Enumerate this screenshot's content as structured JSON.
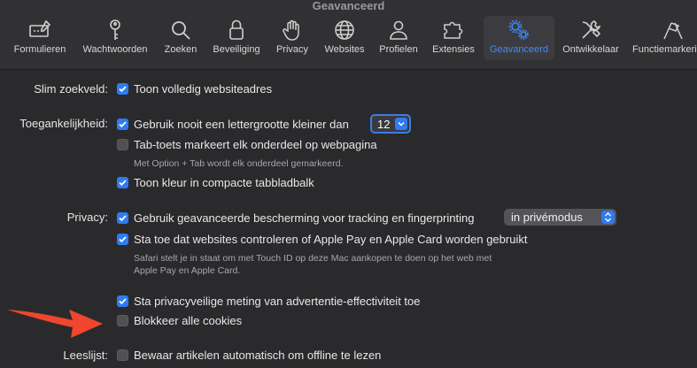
{
  "window": {
    "title": "Geavanceerd"
  },
  "toolbar": {
    "items": [
      {
        "label": "Formulieren",
        "icon": "form-icon"
      },
      {
        "label": "Wachtwoorden",
        "icon": "key-icon"
      },
      {
        "label": "Zoeken",
        "icon": "search-icon"
      },
      {
        "label": "Beveiliging",
        "icon": "lock-icon"
      },
      {
        "label": "Privacy",
        "icon": "hand-icon"
      },
      {
        "label": "Websites",
        "icon": "globe-icon"
      },
      {
        "label": "Profielen",
        "icon": "person-icon"
      },
      {
        "label": "Extensies",
        "icon": "puzzle-icon"
      },
      {
        "label": "Geavanceerd",
        "icon": "gears-icon",
        "active": true
      },
      {
        "label": "Ontwikkelaar",
        "icon": "tools-icon"
      },
      {
        "label": "Functiemarkeringen",
        "icon": "flags-icon"
      }
    ]
  },
  "settings": {
    "smart_search": {
      "label": "Slim zoekveld:",
      "full_address": {
        "text": "Toon volledig websiteadres",
        "checked": true
      }
    },
    "accessibility": {
      "label": "Toegankelijkheid:",
      "min_font": {
        "text": "Gebruik nooit een lettergrootte kleiner dan",
        "checked": true,
        "value": "12"
      },
      "tab_key": {
        "text": "Tab-toets markeert elk onderdeel op webpagina",
        "checked": false,
        "help": "Met Option + Tab wordt elk onderdeel gemarkeerd."
      },
      "compact_color": {
        "text": "Toon kleur in compacte tabbladbalk",
        "checked": true
      }
    },
    "privacy": {
      "label": "Privacy:",
      "advanced_protection": {
        "text": "Gebruik geavanceerde bescherming voor tracking en fingerprinting",
        "checked": true,
        "mode": "in privémodus"
      },
      "apple_pay": {
        "text": "Sta toe dat websites controleren of Apple Pay en Apple Card worden gebruikt",
        "checked": true,
        "help1": "Safari stelt je in staat om met Touch ID op deze Mac aankopen te doen op het web met",
        "help2": "Apple Pay en Apple Card."
      },
      "ad_measure": {
        "text": "Sta privacyveilige meting van advertentie-effectiviteit toe",
        "checked": true
      },
      "block_cookies": {
        "text": "Blokkeer alle cookies",
        "checked": false
      }
    },
    "reading_list": {
      "label": "Leeslijst:",
      "offline": {
        "text": "Bewaar artikelen automatisch om offline te lezen",
        "checked": false
      }
    }
  },
  "colors": {
    "accent": "#2f7bf5",
    "arrow": "#f0462e",
    "background": "#2a2a2c"
  }
}
